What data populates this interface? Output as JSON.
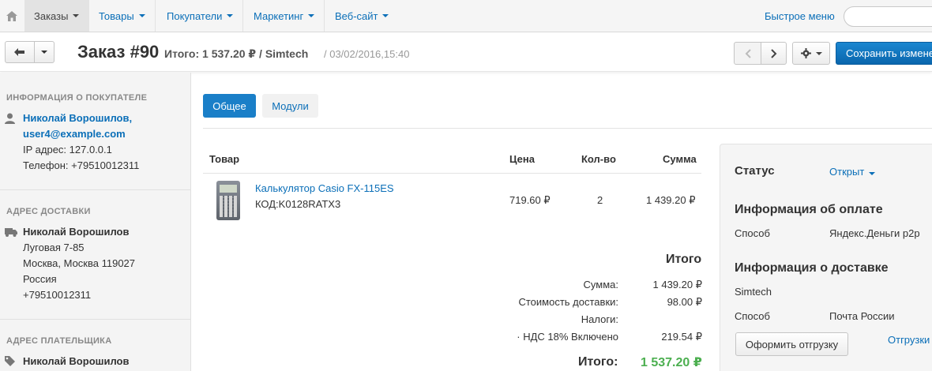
{
  "nav": {
    "items": [
      {
        "label": "Заказы"
      },
      {
        "label": "Товары"
      },
      {
        "label": "Покупатели"
      },
      {
        "label": "Маркетинг"
      },
      {
        "label": "Веб-сайт"
      }
    ],
    "quick_menu": "Быстрое меню",
    "search_placeholder": ""
  },
  "header": {
    "title": "Заказ #90",
    "total": "Итого: 1 537.20 ₽ / Simtech",
    "date": "/ 03/02/2016,15:40",
    "save_label": "Сохранить изменения"
  },
  "sidebar": {
    "customer": {
      "heading": "ИНФОРМАЦИЯ О ПОКУПАТЕЛЕ",
      "name": "Николай Ворошилов,",
      "email": "user4@example.com",
      "ip": "IP адрес: 127.0.0.1",
      "phone": "Телефон: +79510012311"
    },
    "shipping": {
      "heading": "АДРЕС ДОСТАВКИ",
      "name": "Николай Ворошилов",
      "street": "Луговая 7-85",
      "city": "Москва, Москва 119027",
      "country": "Россия",
      "phone": "+79510012311"
    },
    "billing": {
      "heading": "АДРЕС ПЛАТЕЛЬЩИКА",
      "name": "Николай Ворошилов"
    }
  },
  "tabs": [
    {
      "label": "Общее"
    },
    {
      "label": "Модули"
    }
  ],
  "table": {
    "headers": {
      "product": "Товар",
      "price": "Цена",
      "qty": "Кол-во",
      "sum": "Сумма"
    },
    "rows": [
      {
        "name": "Калькулятор Casio FX-115ES",
        "code": "КОД:K0128RATX3",
        "price": "719.60 ₽",
        "qty": "2",
        "sum": "1 439.20 ₽"
      }
    ]
  },
  "totals": {
    "heading": "Итого",
    "subtotal_label": "Сумма:",
    "subtotal": "1 439.20 ₽",
    "shipping_label": "Стоимость доставки:",
    "shipping": "98.00 ₽",
    "taxes_label": "Налоги:",
    "vat_label": "· НДС 18% Включено",
    "vat": "219.54 ₽",
    "grand_label": "Итого:",
    "grand": "1 537.20 ₽"
  },
  "status_panel": {
    "status_label": "Статус",
    "status_value": "Открыт",
    "payment_heading": "Информация об оплате",
    "payment_method_label": "Способ",
    "payment_method": "Яндекс.Деньги p2p",
    "delivery_heading": "Информация о доставке",
    "carrier": "Simtech",
    "delivery_method_label": "Способ",
    "delivery_method": "Почта России",
    "ship_button": "Оформить отгрузку",
    "shipments_link": "Отгрузки"
  }
}
